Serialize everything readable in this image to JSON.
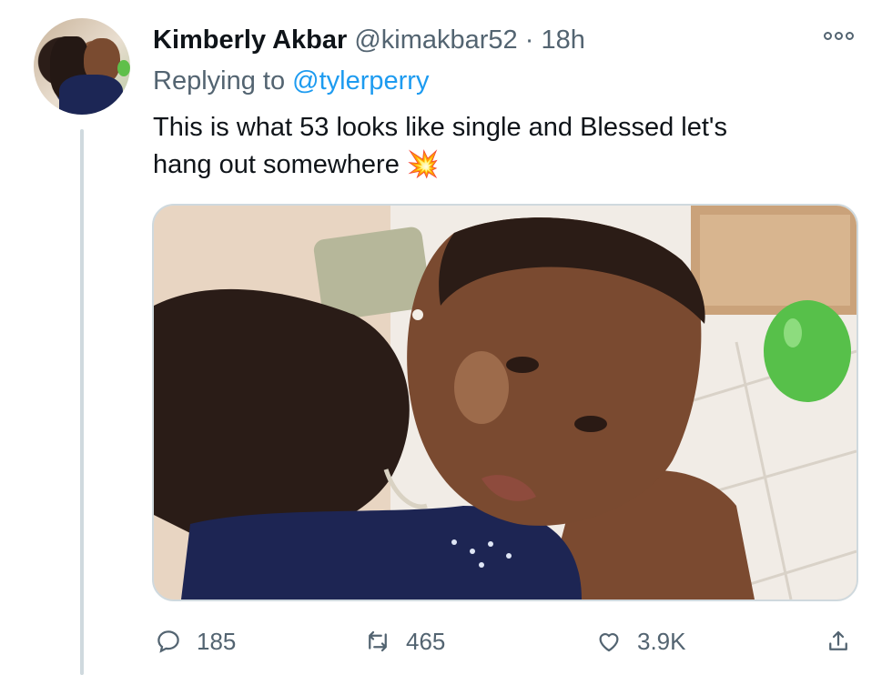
{
  "tweet": {
    "author_name": "Kimberly Akbar",
    "author_handle": "@kimakbar52",
    "separator": "·",
    "time": "18h",
    "replying_prefix": "Replying to",
    "replying_handle": "@tylerperry",
    "text_line_1": "This is what 53 looks like single and Blessed let's",
    "text_line_2": "hang out somewhere",
    "emoji": "💥"
  },
  "actions": {
    "replies": "185",
    "retweets": "465",
    "likes": "3.9K"
  },
  "icons": {
    "more": "more-icon",
    "reply": "reply-icon",
    "retweet": "retweet-icon",
    "like": "heart-icon",
    "share": "share-icon"
  },
  "colors": {
    "link": "#1d9bf0",
    "secondary_text": "#536471",
    "thread_line": "#cfd9de"
  }
}
